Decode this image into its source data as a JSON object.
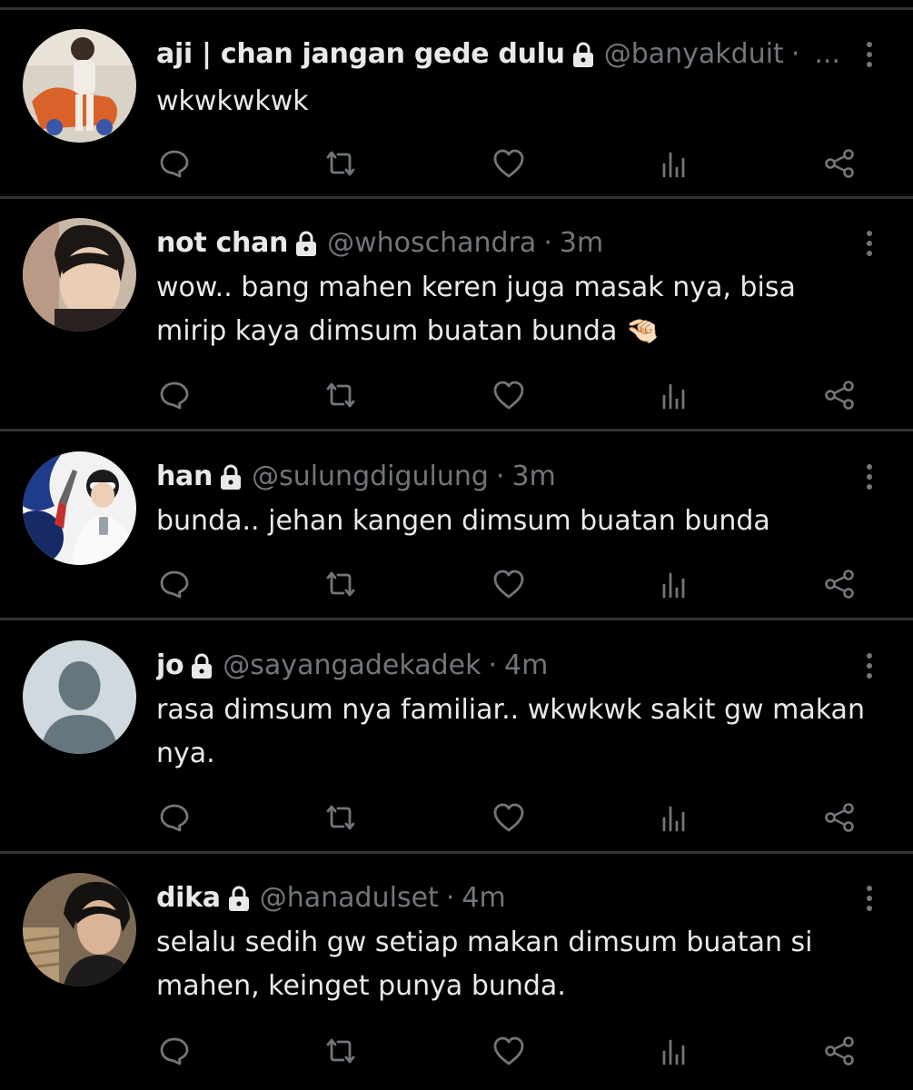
{
  "colors": {
    "background": "#000000",
    "text": "#e7e9ea",
    "secondary": "#71767b",
    "divider": "#2f3336"
  },
  "action_icons": [
    "reply-icon",
    "retweet-icon",
    "like-icon",
    "views-icon",
    "share-icon"
  ],
  "tweets": [
    {
      "name": "aji | chan jangan gede dulu",
      "handle": "@banyakduit",
      "separator": "·",
      "time": "",
      "truncated": "...",
      "text": "wkwkwkwk",
      "avatar": "photo-child"
    },
    {
      "name": "not chan",
      "handle": "@whoschandra",
      "separator": "·",
      "time": "3m",
      "truncated": "",
      "text": "wow.. bang mahen keren juga masak nya, bisa mirip kaya dimsum buatan bunda 🤏🏻",
      "avatar": "photo-boy"
    },
    {
      "name": "han",
      "handle": "@sulungdigulung",
      "separator": "·",
      "time": "3m",
      "truncated": "",
      "text": "bunda.. jehan kangen dimsum buatan bunda",
      "avatar": "photo-sunglasses"
    },
    {
      "name": "jo",
      "handle": "@sayangadekadek",
      "separator": "·",
      "time": "4m",
      "truncated": "",
      "text": "rasa dimsum nya familiar.. wkwkwk sakit gw makan nya.",
      "avatar": "default-avatar"
    },
    {
      "name": "dika",
      "handle": "@hanadulset",
      "separator": "·",
      "time": "4m",
      "truncated": "",
      "text": "selalu sedih gw setiap makan dimsum buatan si mahen, keinget punya bunda.",
      "avatar": "photo-dark-hair"
    }
  ]
}
